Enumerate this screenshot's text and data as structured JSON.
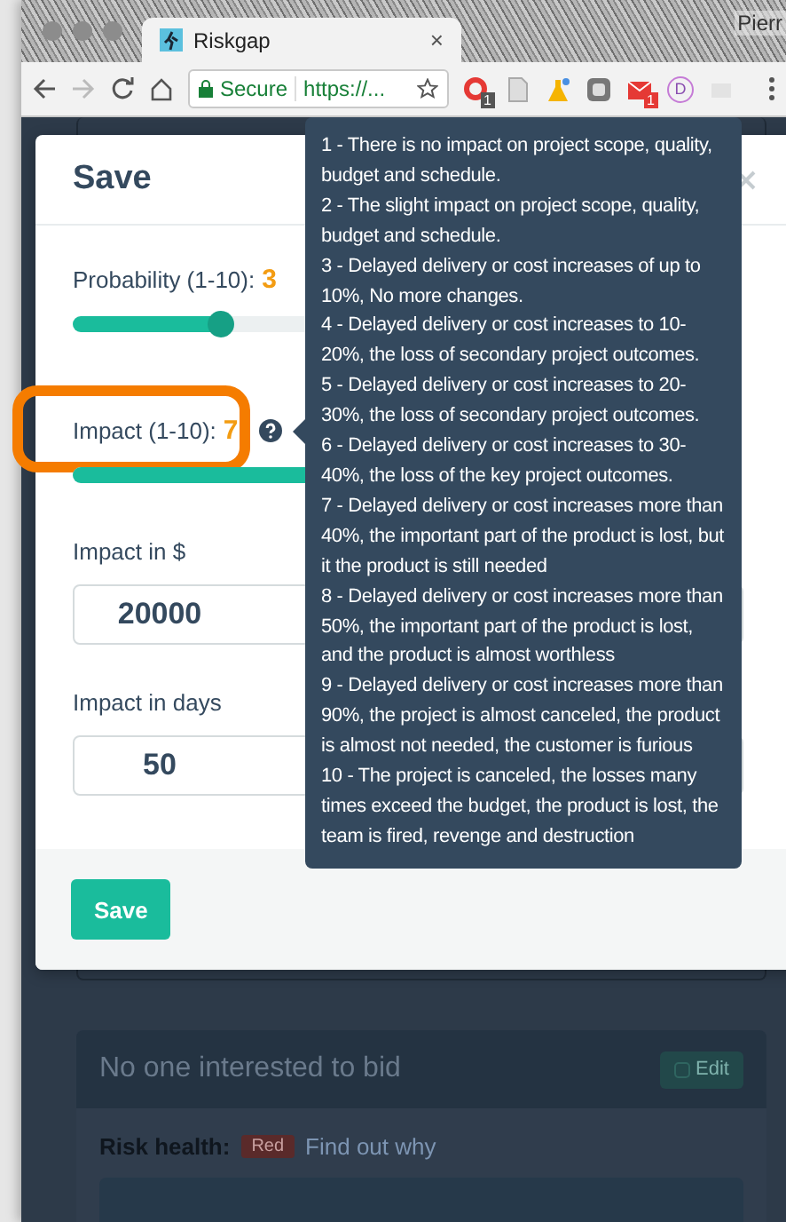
{
  "browser": {
    "tab_title": "Riskgap",
    "tab_close": "×",
    "secure_label": "Secure",
    "address": "https://...",
    "profile_name": "Pierr",
    "extensions": [
      {
        "kind": "ring",
        "badge": "1"
      },
      {
        "kind": "doc"
      },
      {
        "kind": "flask"
      },
      {
        "kind": "square"
      },
      {
        "kind": "mail",
        "badge": "1"
      },
      {
        "kind": "letter",
        "label": "D"
      },
      {
        "kind": "faded"
      }
    ]
  },
  "modal": {
    "title": "Save",
    "fields": [
      {
        "kind": "slider",
        "label": "Probability (1-10):",
        "value": "3",
        "help": false,
        "highlighted": false
      },
      {
        "kind": "slider",
        "label": "Impact (1-10):",
        "value": "7",
        "help": true,
        "highlighted": true
      },
      {
        "kind": "input",
        "label": "Impact in $",
        "value": "20000"
      },
      {
        "kind": "input",
        "label": "Impact in days",
        "value": "50"
      }
    ],
    "save_button": "Save"
  },
  "tooltip": {
    "lines": [
      "1 - There is no impact on project scope, quality, budget and schedule.",
      "2 - The slight impact on project scope, quality, budget and schedule.",
      "3 - Delayed delivery or cost increases of up to 10%, No more changes.",
      "4 - Delayed delivery or cost increases to 10-20%, the loss of secondary project outcomes.",
      "5 - Delayed delivery or cost increases to 20-30%, the loss of secondary project outcomes.",
      "6 - Delayed delivery or cost increases to 30-40%, the loss of the key project outcomes.",
      "7 - Delayed delivery or cost increases more than 40%, the important part of the product is lost, but it the product is still needed",
      "8 - Delayed delivery or cost increases more than 50%, the important part of the product is lost, and the product is almost worthless",
      "9 - Delayed delivery or cost increases more than 90%, the project is almost canceled, the product is almost not needed, the customer is furious",
      "10 - The project is canceled, the losses many times exceed the budget, the product is lost, the team is fired, revenge and destruction"
    ]
  },
  "background_card": {
    "title": "No one interested to bid",
    "edit_button": "Edit",
    "health_label": "Risk health:",
    "health_badge": "Red",
    "link": "Find out why"
  }
}
